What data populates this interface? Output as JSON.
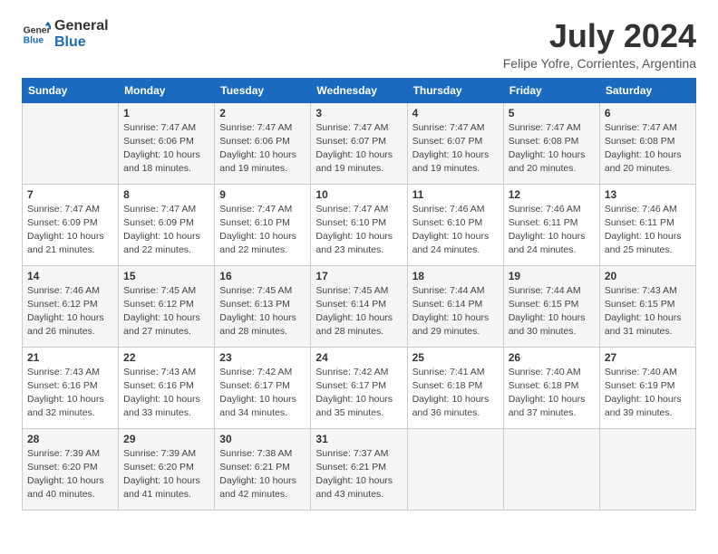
{
  "header": {
    "logo_line1": "General",
    "logo_line2": "Blue",
    "month_title": "July 2024",
    "location": "Felipe Yofre, Corrientes, Argentina"
  },
  "days_of_week": [
    "Sunday",
    "Monday",
    "Tuesday",
    "Wednesday",
    "Thursday",
    "Friday",
    "Saturday"
  ],
  "weeks": [
    [
      {
        "day": "",
        "info": ""
      },
      {
        "day": "1",
        "info": "Sunrise: 7:47 AM\nSunset: 6:06 PM\nDaylight: 10 hours\nand 18 minutes."
      },
      {
        "day": "2",
        "info": "Sunrise: 7:47 AM\nSunset: 6:06 PM\nDaylight: 10 hours\nand 19 minutes."
      },
      {
        "day": "3",
        "info": "Sunrise: 7:47 AM\nSunset: 6:07 PM\nDaylight: 10 hours\nand 19 minutes."
      },
      {
        "day": "4",
        "info": "Sunrise: 7:47 AM\nSunset: 6:07 PM\nDaylight: 10 hours\nand 19 minutes."
      },
      {
        "day": "5",
        "info": "Sunrise: 7:47 AM\nSunset: 6:08 PM\nDaylight: 10 hours\nand 20 minutes."
      },
      {
        "day": "6",
        "info": "Sunrise: 7:47 AM\nSunset: 6:08 PM\nDaylight: 10 hours\nand 20 minutes."
      }
    ],
    [
      {
        "day": "7",
        "info": "Sunrise: 7:47 AM\nSunset: 6:09 PM\nDaylight: 10 hours\nand 21 minutes."
      },
      {
        "day": "8",
        "info": "Sunrise: 7:47 AM\nSunset: 6:09 PM\nDaylight: 10 hours\nand 22 minutes."
      },
      {
        "day": "9",
        "info": "Sunrise: 7:47 AM\nSunset: 6:10 PM\nDaylight: 10 hours\nand 22 minutes."
      },
      {
        "day": "10",
        "info": "Sunrise: 7:47 AM\nSunset: 6:10 PM\nDaylight: 10 hours\nand 23 minutes."
      },
      {
        "day": "11",
        "info": "Sunrise: 7:46 AM\nSunset: 6:10 PM\nDaylight: 10 hours\nand 24 minutes."
      },
      {
        "day": "12",
        "info": "Sunrise: 7:46 AM\nSunset: 6:11 PM\nDaylight: 10 hours\nand 24 minutes."
      },
      {
        "day": "13",
        "info": "Sunrise: 7:46 AM\nSunset: 6:11 PM\nDaylight: 10 hours\nand 25 minutes."
      }
    ],
    [
      {
        "day": "14",
        "info": "Sunrise: 7:46 AM\nSunset: 6:12 PM\nDaylight: 10 hours\nand 26 minutes."
      },
      {
        "day": "15",
        "info": "Sunrise: 7:45 AM\nSunset: 6:12 PM\nDaylight: 10 hours\nand 27 minutes."
      },
      {
        "day": "16",
        "info": "Sunrise: 7:45 AM\nSunset: 6:13 PM\nDaylight: 10 hours\nand 28 minutes."
      },
      {
        "day": "17",
        "info": "Sunrise: 7:45 AM\nSunset: 6:14 PM\nDaylight: 10 hours\nand 28 minutes."
      },
      {
        "day": "18",
        "info": "Sunrise: 7:44 AM\nSunset: 6:14 PM\nDaylight: 10 hours\nand 29 minutes."
      },
      {
        "day": "19",
        "info": "Sunrise: 7:44 AM\nSunset: 6:15 PM\nDaylight: 10 hours\nand 30 minutes."
      },
      {
        "day": "20",
        "info": "Sunrise: 7:43 AM\nSunset: 6:15 PM\nDaylight: 10 hours\nand 31 minutes."
      }
    ],
    [
      {
        "day": "21",
        "info": "Sunrise: 7:43 AM\nSunset: 6:16 PM\nDaylight: 10 hours\nand 32 minutes."
      },
      {
        "day": "22",
        "info": "Sunrise: 7:43 AM\nSunset: 6:16 PM\nDaylight: 10 hours\nand 33 minutes."
      },
      {
        "day": "23",
        "info": "Sunrise: 7:42 AM\nSunset: 6:17 PM\nDaylight: 10 hours\nand 34 minutes."
      },
      {
        "day": "24",
        "info": "Sunrise: 7:42 AM\nSunset: 6:17 PM\nDaylight: 10 hours\nand 35 minutes."
      },
      {
        "day": "25",
        "info": "Sunrise: 7:41 AM\nSunset: 6:18 PM\nDaylight: 10 hours\nand 36 minutes."
      },
      {
        "day": "26",
        "info": "Sunrise: 7:40 AM\nSunset: 6:18 PM\nDaylight: 10 hours\nand 37 minutes."
      },
      {
        "day": "27",
        "info": "Sunrise: 7:40 AM\nSunset: 6:19 PM\nDaylight: 10 hours\nand 39 minutes."
      }
    ],
    [
      {
        "day": "28",
        "info": "Sunrise: 7:39 AM\nSunset: 6:20 PM\nDaylight: 10 hours\nand 40 minutes."
      },
      {
        "day": "29",
        "info": "Sunrise: 7:39 AM\nSunset: 6:20 PM\nDaylight: 10 hours\nand 41 minutes."
      },
      {
        "day": "30",
        "info": "Sunrise: 7:38 AM\nSunset: 6:21 PM\nDaylight: 10 hours\nand 42 minutes."
      },
      {
        "day": "31",
        "info": "Sunrise: 7:37 AM\nSunset: 6:21 PM\nDaylight: 10 hours\nand 43 minutes."
      },
      {
        "day": "",
        "info": ""
      },
      {
        "day": "",
        "info": ""
      },
      {
        "day": "",
        "info": ""
      }
    ]
  ]
}
